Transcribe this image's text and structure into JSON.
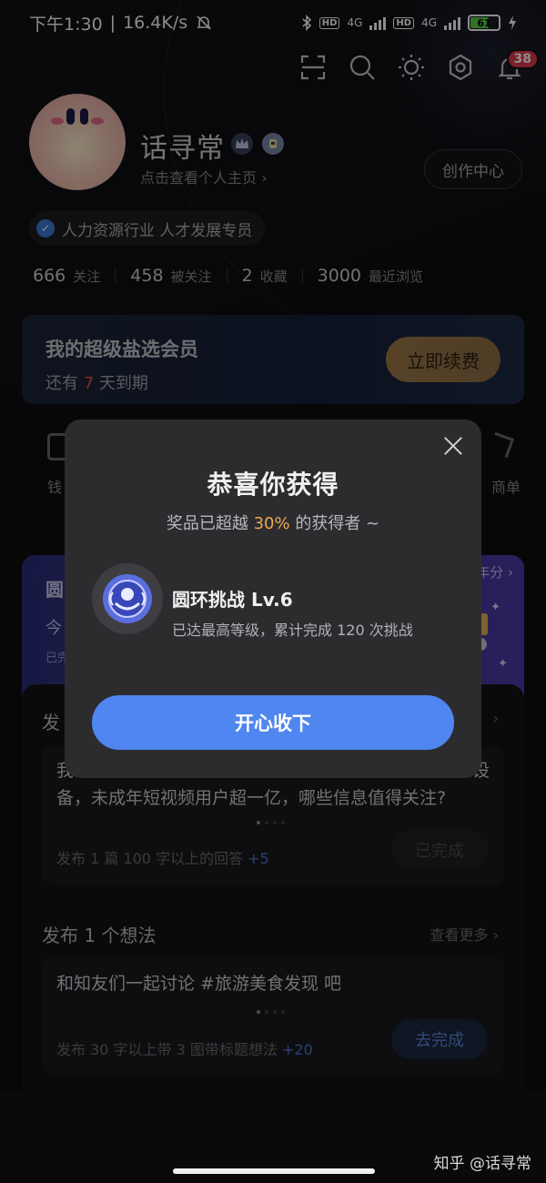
{
  "status_bar": {
    "time": "下午1:30",
    "speed": "16.4K/s",
    "hd1": "HD",
    "net1": "4G",
    "hd2": "HD",
    "net2": "4G",
    "battery": "61",
    "icons": [
      "mute-icon",
      "bluetooth-icon",
      "signal-icon",
      "charging-icon"
    ]
  },
  "toolbar": {
    "icons": [
      "scan-icon",
      "search-icon",
      "theme-icon",
      "settings-icon",
      "notification-icon"
    ],
    "notification_count": "38"
  },
  "profile": {
    "name": "话寻常",
    "homepage_link": "点击查看个人主页 ›",
    "creator_center": "创作中心",
    "certification": "人力资源行业 人才发展专员"
  },
  "stats": [
    {
      "value": "666",
      "label": "关注"
    },
    {
      "value": "458",
      "label": "被关注"
    },
    {
      "value": "2",
      "label": "收藏"
    },
    {
      "value": "3000",
      "label": "最近浏览"
    }
  ],
  "membership": {
    "title": "我的超级盐选会员",
    "remaining_prefix": "还有",
    "remaining_days": "7",
    "remaining_suffix": "天到期",
    "renew_button": "立即续费"
  },
  "quick_items": {
    "left_label": "钱",
    "right_label": "商单"
  },
  "challenge": {
    "title": "圆",
    "subtitle": "今",
    "tiny": "已完",
    "right_text": "年分 ›"
  },
  "tasks": {
    "answer_task": {
      "title": "发",
      "more": "›",
      "question_line1": "我",
      "question_line1_tail": "设",
      "question_line2": "备，未成年短视频用户超一亿，哪些信息值得关注?",
      "requirement": "发布 1 篇 100 字以上的回答",
      "points": "+5",
      "button": "已完成"
    },
    "idea_task": {
      "title": "发布 1 个想法",
      "more": "查看更多 ›",
      "prompt": "和知友们一起讨论 #旅游美食发现 吧",
      "requirement": "发布 30 字以上带 3 图带标题想法",
      "points": "+20",
      "button": "去完成"
    }
  },
  "modal": {
    "title": "恭喜你获得",
    "subtitle_prefix": "奖品已超越",
    "subtitle_percent": "30%",
    "subtitle_suffix": "的获得者 ~",
    "prize_name": "圆环挑战 Lv.6",
    "prize_desc": "已达最高等级，累计完成 120 次挑战",
    "accept_button": "开心收下"
  },
  "watermark": "知乎 @话寻常",
  "colors": {
    "accent_blue": "#4f86f0",
    "orange_highlight": "#f0a84e",
    "red_highlight": "#e0564a",
    "badge_red": "#e03a4a"
  }
}
